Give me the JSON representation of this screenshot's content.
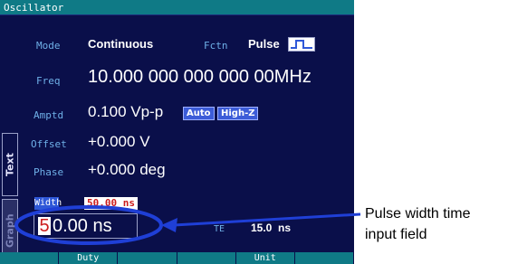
{
  "window": {
    "title": "Oscillator"
  },
  "tabs": {
    "text": "Text",
    "graph": "Graph"
  },
  "params": {
    "mode": {
      "label": "Mode",
      "value": "Continuous"
    },
    "fctn": {
      "label": "Fctn",
      "value": "Pulse",
      "icon": "pulse-waveform-icon"
    },
    "freq": {
      "label": "Freq",
      "value": "10.000 000 000 000 00MHz"
    },
    "amptd": {
      "label": "Amptd",
      "value": "0.100 Vp-p",
      "badges": [
        "Auto",
        "High-Z"
      ]
    },
    "offset": {
      "label": "Offset",
      "value": "+0.000 V"
    },
    "phase": {
      "label": "Phase",
      "value": "+0.000 deg"
    },
    "width": {
      "label": "Width",
      "value": "50.00 ns"
    },
    "te": {
      "label": "TE",
      "value": "15.0  ns"
    }
  },
  "input": {
    "cursor_digit": "5",
    "rest": "0.00 ns"
  },
  "softkeys": [
    "",
    "Duty",
    "",
    "",
    "Unit",
    ""
  ],
  "callout": {
    "line1": "Pulse width time",
    "line2": "input field"
  },
  "colors": {
    "screen_bg": "#0a0f4a",
    "title_bg": "#0f7a86",
    "label": "#6fb0e8",
    "badge": "#3c5cd8",
    "highlight_red": "#cc1d1d",
    "callout": "#1f3fd6"
  }
}
